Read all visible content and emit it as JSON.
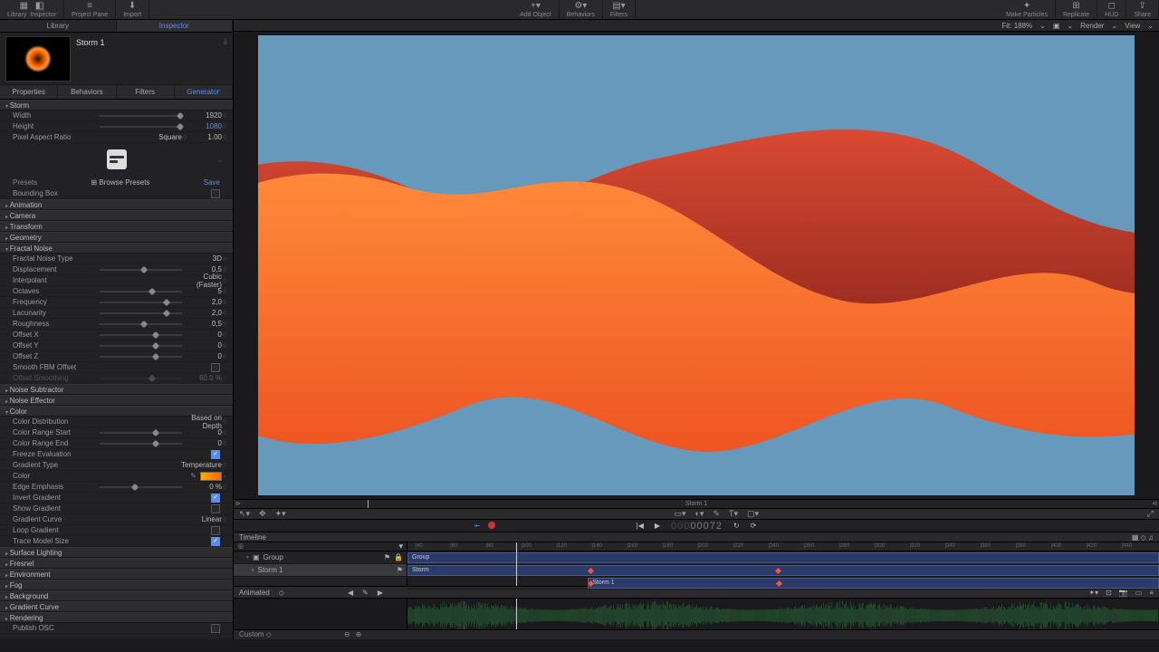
{
  "topbar": {
    "library": "Library",
    "inspector": "Inspector",
    "project_pane": "Project Pane",
    "import": "Import",
    "add_object": "Add Object",
    "behaviors": "Behaviors",
    "filters": "Filters",
    "make_particles": "Make Particles",
    "replicate": "Replicate",
    "hud": "HUD",
    "share": "Share"
  },
  "left_tabs": {
    "library": "Library",
    "inspector": "Inspector"
  },
  "object": {
    "name": "Storm 1"
  },
  "insp_tabs": {
    "properties": "Properties",
    "behaviors": "Behaviors",
    "filters": "Filters",
    "generator": "Generator"
  },
  "sections": {
    "storm": "Storm",
    "animation": "Animation",
    "camera": "Camera",
    "transform": "Transform",
    "geometry": "Geometry",
    "fractal_noise": "Fractal Noise",
    "noise_subtractor": "Noise Subtractor",
    "noise_effector": "Noise Effector",
    "color": "Color",
    "surface_lighting": "Surface Lighting",
    "fresnel": "Fresnel",
    "environment": "Environment",
    "fog": "Fog",
    "background": "Background",
    "gradient_curve": "Gradient Curve",
    "rendering": "Rendering",
    "publish_osc": "Publish OSC"
  },
  "storm": {
    "width_label": "Width",
    "width": "1920",
    "height_label": "Height",
    "height": "1080",
    "par_label": "Pixel Aspect Ratio",
    "par_mode": "Square",
    "par_val": "1.00",
    "presets_label": "Presets",
    "browse": "Browse Presets",
    "save": "Save",
    "bbox_label": "Bounding Box"
  },
  "fn": {
    "type_label": "Fractal Noise Type",
    "type": "3D",
    "disp_label": "Displacement",
    "disp": "0,5",
    "interp_label": "Interpolant",
    "interp": "Cubic (Faster)",
    "oct_label": "Octaves",
    "oct": "5",
    "freq_label": "Frequency",
    "freq": "2,0",
    "lac_label": "Lacunarity",
    "lac": "2,0",
    "rough_label": "Roughness",
    "rough": "0,5",
    "ox_label": "Offset X",
    "ox": "0",
    "oy_label": "Offset Y",
    "oy": "0",
    "oz_label": "Offset Z",
    "oz": "0",
    "sfbm_label": "Smooth FBM Offset",
    "smooth_label": "Offset Smoothing",
    "smooth": "60.0 %"
  },
  "color": {
    "dist_label": "Color Distribution",
    "dist": "Based on Depth",
    "crs_label": "Color Range Start",
    "crs": "0",
    "cre_label": "Color Range End",
    "cre": "0",
    "freeze_label": "Freeze Evaluation",
    "gtype_label": "Gradient Type",
    "gtype": "Temperature",
    "color_label": "Color",
    "edge_label": "Edge Emphasis",
    "edge": "0 %",
    "invert_label": "Invert Gradient",
    "show_label": "Show Gradient",
    "curve_label": "Gradient Curve",
    "curve": "Linear",
    "loop_label": "Loop Gradient",
    "trace_label": "Trace Model Size"
  },
  "canvas": {
    "fit": "Fit: 188%",
    "render": "Render",
    "view": "View"
  },
  "transport": {
    "timecode": "00072",
    "project_label": "Storm 1"
  },
  "timeline": {
    "header": "Timeline",
    "group": "Group",
    "storm": "Storm",
    "storm1": "Storm 1",
    "animated": "Animated",
    "ruler": [
      "|40",
      "|60",
      "|80",
      "|100",
      "|120",
      "|140",
      "|160",
      "|180",
      "|200",
      "|220",
      "|240",
      "|260",
      "|280",
      "|300",
      "|320",
      "|340",
      "|360",
      "|380",
      "|400",
      "|420",
      "|440"
    ],
    "custom": "Custom"
  },
  "colors": {
    "sky": "#6699bb",
    "wave1a": "#ff7a33",
    "wave1b": "#ee5522",
    "wave2a": "#dd4433",
    "wave2b": "#aa2a22"
  }
}
